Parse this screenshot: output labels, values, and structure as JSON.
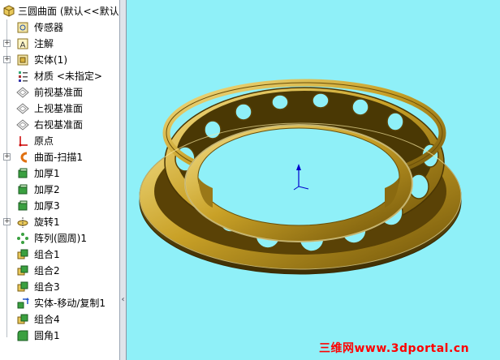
{
  "tree": {
    "root": {
      "label": "三圆曲面 (默认<<默认"
    },
    "items": [
      {
        "label": "传感器",
        "icon": "sensor-icon",
        "expander": ""
      },
      {
        "label": "注解",
        "icon": "annotation-icon",
        "expander": "+"
      },
      {
        "label": "实体(1)",
        "icon": "solid-bodies-icon",
        "expander": "+"
      },
      {
        "label": "材质 <未指定>",
        "icon": "material-icon",
        "expander": ""
      },
      {
        "label": "前视基准面",
        "icon": "plane-icon",
        "expander": ""
      },
      {
        "label": "上视基准面",
        "icon": "plane-icon",
        "expander": ""
      },
      {
        "label": "右视基准面",
        "icon": "plane-icon",
        "expander": ""
      },
      {
        "label": "原点",
        "icon": "origin-icon",
        "expander": ""
      },
      {
        "label": "曲面-扫描1",
        "icon": "surface-sweep-icon",
        "expander": "+"
      },
      {
        "label": "加厚1",
        "icon": "thicken-icon",
        "expander": ""
      },
      {
        "label": "加厚2",
        "icon": "thicken-icon",
        "expander": ""
      },
      {
        "label": "加厚3",
        "icon": "thicken-icon",
        "expander": ""
      },
      {
        "label": "旋转1",
        "icon": "revolve-icon",
        "expander": "+"
      },
      {
        "label": "阵列(圆周)1",
        "icon": "circular-pattern-icon",
        "expander": ""
      },
      {
        "label": "组合1",
        "icon": "combine-icon",
        "expander": ""
      },
      {
        "label": "组合2",
        "icon": "combine-icon",
        "expander": ""
      },
      {
        "label": "组合3",
        "icon": "combine-icon",
        "expander": ""
      },
      {
        "label": "实体-移动/复制1",
        "icon": "move-copy-body-icon",
        "expander": ""
      },
      {
        "label": "组合4",
        "icon": "combine-icon",
        "expander": ""
      },
      {
        "label": "圆角1",
        "icon": "fillet-icon",
        "expander": ""
      }
    ]
  },
  "viewport": {
    "background": "#8ff0f8",
    "model_color": "#c8a020"
  },
  "watermark": {
    "text": "三维网www.3dportal.cn"
  }
}
